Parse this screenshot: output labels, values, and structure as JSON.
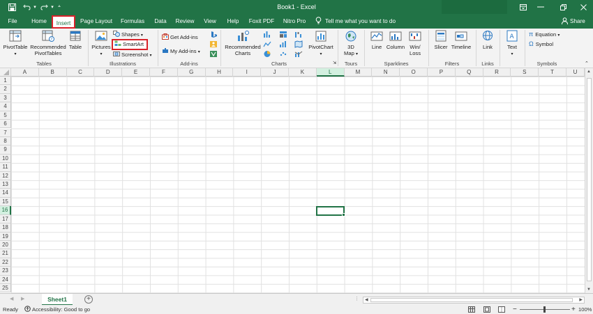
{
  "titlebar": {
    "title": "Book1  -  Excel",
    "icons": [
      "save-icon",
      "undo-icon",
      "redo-icon",
      "customize-icon",
      "ribbon-display-icon",
      "minimize-icon",
      "restore-icon",
      "close-icon"
    ]
  },
  "menu": {
    "items": [
      "File",
      "Home",
      "Insert",
      "Page Layout",
      "Formulas",
      "Data",
      "Review",
      "View",
      "Help",
      "Foxit PDF",
      "Nitro Pro"
    ],
    "active": "Insert",
    "tell_me": "Tell me what you want to do",
    "share": "Share"
  },
  "ribbon": {
    "tables": {
      "label": "Tables",
      "pivottable": "PivotTable",
      "recommended_pivottables": [
        "Recommended",
        "PivotTables"
      ],
      "table": "Table"
    },
    "illustrations": {
      "label": "Illustrations",
      "pictures": "Pictures",
      "shapes": "Shapes",
      "smartart": "SmartArt",
      "screenshot": "Screenshot"
    },
    "addins": {
      "label": "Add-ins",
      "get_addins": "Get Add-ins",
      "my_addins": "My Add-ins"
    },
    "charts": {
      "label": "Charts",
      "recommended_charts": [
        "Recommended",
        "Charts"
      ],
      "pivotchart": "PivotChart"
    },
    "tours": {
      "label": "Tours",
      "map3d": [
        "3D",
        "Map"
      ]
    },
    "sparklines": {
      "label": "Sparklines",
      "line": "Line",
      "column": "Column",
      "winloss": [
        "Win/",
        "Loss"
      ]
    },
    "filters": {
      "label": "Filters",
      "slicer": "Slicer",
      "timeline": "Timeline"
    },
    "links": {
      "label": "Links",
      "link": "Link"
    },
    "text": {
      "text": "Text"
    },
    "symbols": {
      "label": "Symbols",
      "equation": "Equation",
      "symbol": "Symbol"
    }
  },
  "grid": {
    "columns": [
      "A",
      "B",
      "C",
      "D",
      "E",
      "F",
      "G",
      "H",
      "I",
      "J",
      "K",
      "L",
      "M",
      "N",
      "O",
      "P",
      "Q",
      "R",
      "S",
      "T",
      "U"
    ],
    "rows": [
      "1",
      "2",
      "3",
      "4",
      "5",
      "6",
      "7",
      "8",
      "9",
      "10",
      "11",
      "12",
      "13",
      "14",
      "15",
      "16",
      "17",
      "18",
      "19",
      "20",
      "21",
      "22",
      "23",
      "24",
      "25"
    ],
    "selected_column": "L",
    "selected_row": "16"
  },
  "sheets": {
    "tabs": [
      "Sheet1"
    ]
  },
  "status": {
    "ready": "Ready",
    "accessibility": "Accessibility: Good to go",
    "zoom": "100%"
  },
  "colors": {
    "brand": "#217346",
    "highlight": "#d9222a"
  }
}
